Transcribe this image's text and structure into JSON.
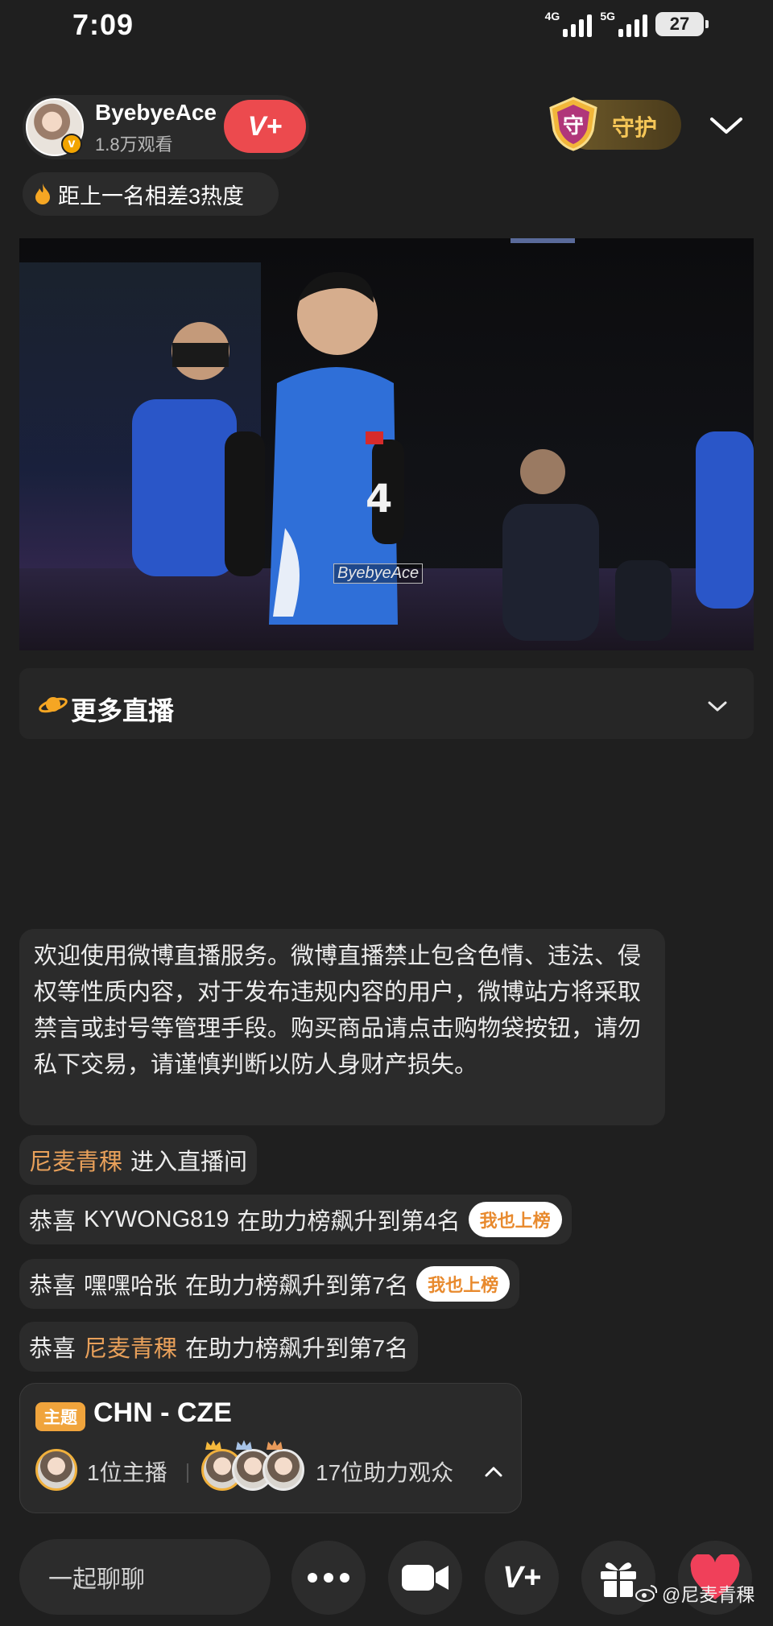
{
  "status": {
    "time": "7:09",
    "net1": "4G",
    "net2": "5G",
    "battery": "27"
  },
  "host": {
    "name": "ByebyeAce",
    "views": "1.8万观看",
    "follow_label": "V+",
    "guard_badge": "守",
    "guard_label": "守护"
  },
  "heat": {
    "text": "距上一名相差3热度"
  },
  "video": {
    "watermark": "ByebyeAce"
  },
  "more_live": {
    "label": "更多直播"
  },
  "chat": {
    "notice": "欢迎使用微博直播服务。微博直播禁止包含色情、违法、侵权等性质内容，对于发布违规内容的用户，微博站方将采取禁言或封号等管理手段。购买商品请点击购物袋按钮，请勿私下交易，请谨慎判断以防人身财产损失。",
    "entry": {
      "user": "尼麦青稞",
      "action": "进入直播间"
    },
    "messages": [
      {
        "prefix": "恭喜",
        "user": "KYWONG819",
        "text": "在助力榜飙升到第4名",
        "button": "我也上榜",
        "highlight": false
      },
      {
        "prefix": "恭喜",
        "user": "嘿嘿哈张",
        "text": "在助力榜飙升到第7名",
        "button": "我也上榜",
        "highlight": false
      },
      {
        "prefix": "恭喜",
        "user": "尼麦青稞",
        "text": "在助力榜飙升到第7名",
        "button": "",
        "highlight": true
      }
    ]
  },
  "topic": {
    "tag": "主题",
    "title": "CHN - CZE",
    "hosts": "1位主播",
    "audience": "17位助力观众"
  },
  "bottom": {
    "chat_placeholder": "一起聊聊",
    "vplus_label": "V+",
    "credit": "@尼麦青稞"
  },
  "colors": {
    "background": "#1f1f1f",
    "accent_red": "#ec4a4e",
    "accent_orange": "#e8a05a",
    "gold": "#f5c657"
  }
}
